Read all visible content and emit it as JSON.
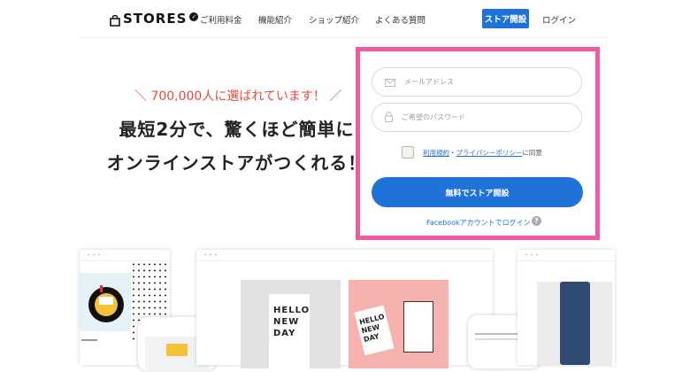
{
  "header": {
    "logo": "STORES",
    "nav": [
      "ご利用料金",
      "機能紹介",
      "ショップ紹介",
      "よくある質問"
    ],
    "cta": "ストア開設",
    "login": "ログイン"
  },
  "hero": {
    "tagline": "＼ 700,000人に選ばれています！ ／",
    "headline_line1": "最短2分で、驚くほど簡単に",
    "headline_line2": "オンラインストアがつくれる！"
  },
  "form": {
    "email_placeholder": "メールアドレス",
    "password_placeholder": "ご希望のパスワード",
    "terms_link": "利用規約",
    "separator": "・",
    "privacy_link": "プライバシーポリシー",
    "agree_suffix": "に同意",
    "submit": "無料でストア開設",
    "facebook_login": "Facebookアカウントでログイン",
    "help": "?"
  },
  "showcase": {
    "card_text_1": "HELLO",
    "card_text_2": "NEW",
    "card_text_3": "DAY",
    "colors": {
      "left_bg": "#e6f3f6",
      "pink_card": "#f6b3ae",
      "gray_card": "#e2e2e2",
      "denim": "#2f4a73"
    }
  }
}
